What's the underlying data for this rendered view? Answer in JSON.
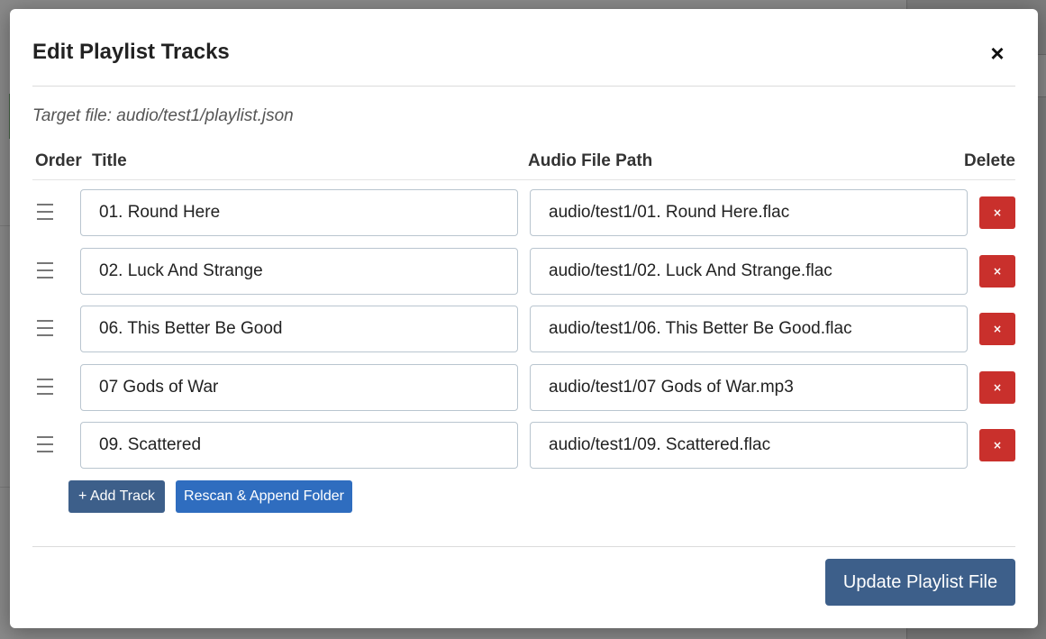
{
  "modal": {
    "title": "Edit Playlist Tracks",
    "close_label": "×",
    "target_file": "Target file: audio/test1/playlist.json"
  },
  "columns": {
    "order": "Order",
    "title": "Title",
    "path": "Audio File Path",
    "delete": "Delete"
  },
  "tracks": [
    {
      "title": "01. Round Here",
      "path": "audio/test1/01. Round Here.flac"
    },
    {
      "title": "02. Luck And Strange",
      "path": "audio/test1/02. Luck And Strange.flac"
    },
    {
      "title": "06. This Better Be Good",
      "path": "audio/test1/06. This Better Be Good.flac"
    },
    {
      "title": "07 Gods of War",
      "path": "audio/test1/07 Gods of War.mp3"
    },
    {
      "title": "09. Scattered",
      "path": "audio/test1/09. Scattered.flac"
    }
  ],
  "buttons": {
    "delete_label": "×",
    "add_track": "+ Add Track",
    "rescan": "Rescan & Append Folder",
    "update": "Update Playlist File"
  },
  "colors": {
    "primary": "#3d5f8a",
    "secondary": "#2f6dbf",
    "danger": "#c9302c"
  },
  "icons": {
    "close": "close-icon",
    "drag": "drag-handle-icon",
    "delete": "delete-icon"
  }
}
